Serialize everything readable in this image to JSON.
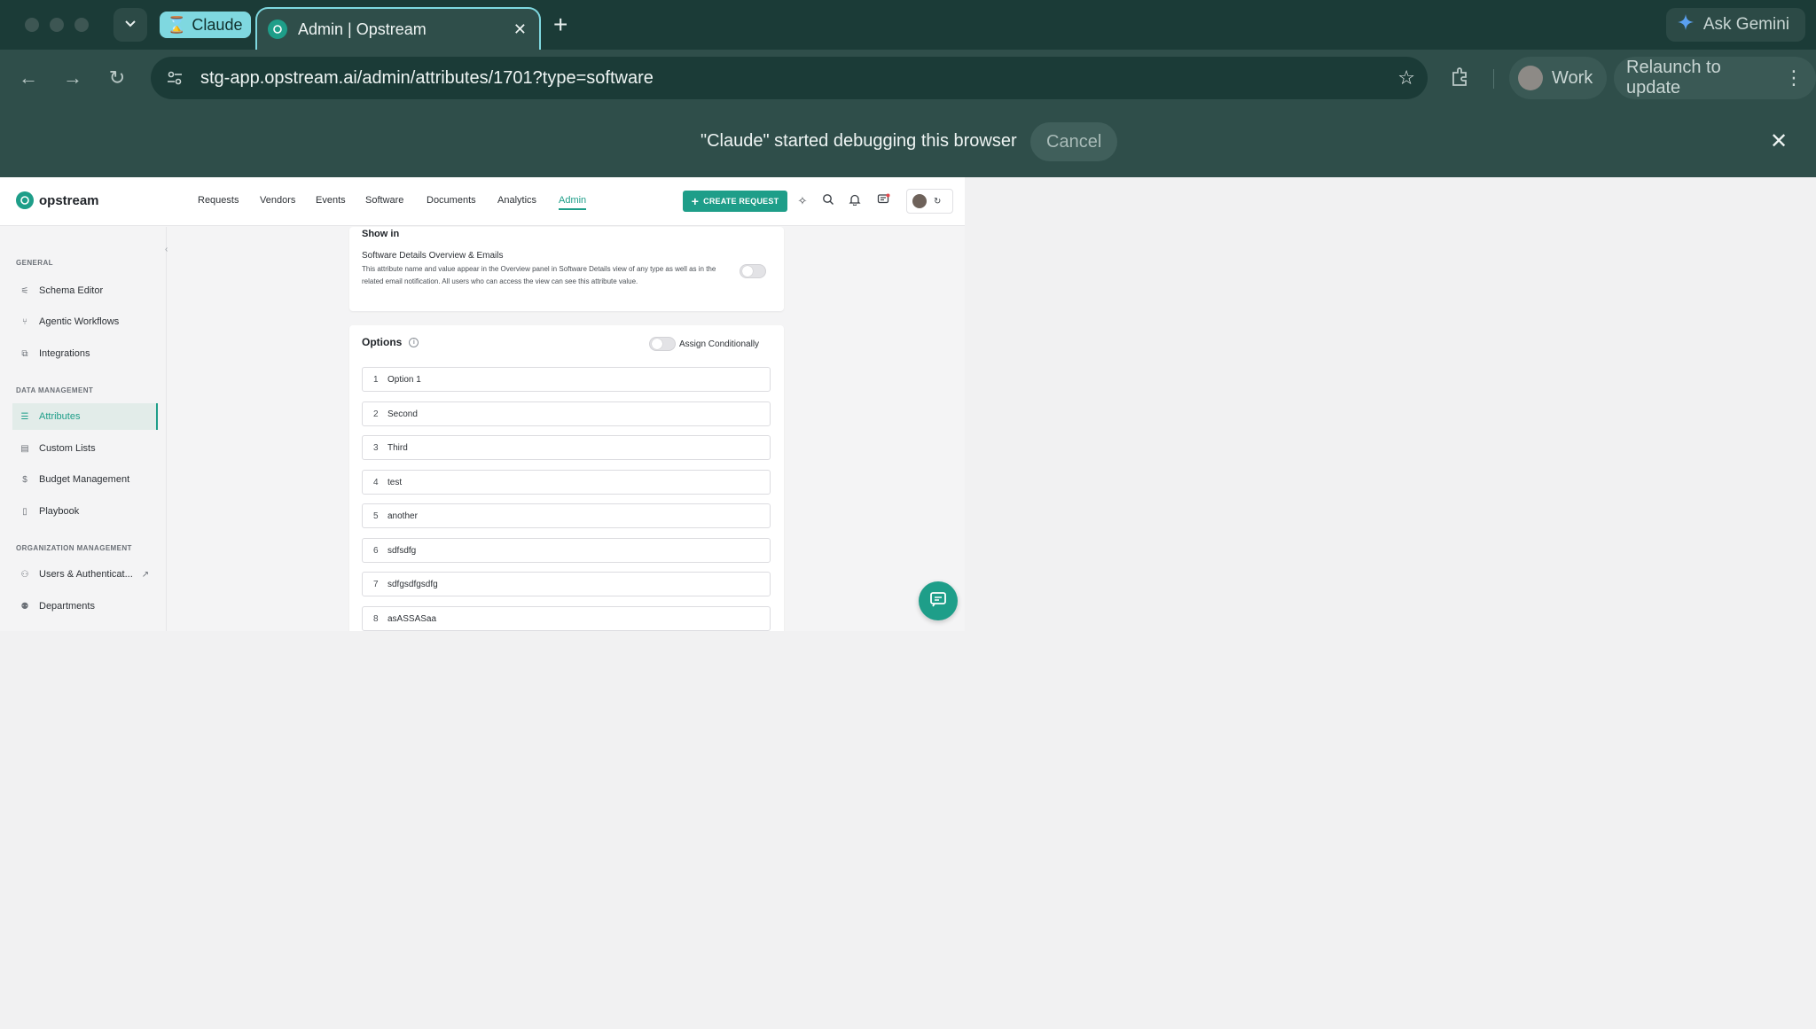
{
  "browser": {
    "claude_tab_label": "Claude",
    "active_tab_title": "Admin | Opstream",
    "gemini_label": "Ask Gemini",
    "url": "stg-app.opstream.ai/admin/attributes/1701?type=software",
    "profile_label": "Work",
    "relaunch_label": "Relaunch to update",
    "debug_message": "\"Claude\" started debugging this browser",
    "debug_cancel": "Cancel"
  },
  "app": {
    "logo_text": "opstream",
    "nav": [
      "Requests",
      "Vendors",
      "Events",
      "Software",
      "Documents",
      "Analytics",
      "Admin"
    ],
    "active_nav": "Admin",
    "create_label": "CREATE REQUEST",
    "accent_color": "#1e9e89"
  },
  "sidebar": {
    "sections": [
      {
        "label": "GENERAL",
        "items": [
          "Schema Editor",
          "Agentic Workflows",
          "Integrations"
        ]
      },
      {
        "label": "DATA MANAGEMENT",
        "items": [
          "Attributes",
          "Custom Lists",
          "Budget Management",
          "Playbook"
        ]
      },
      {
        "label": "ORGANIZATION MANAGEMENT",
        "items": [
          "Users & Authenticat...",
          "Departments"
        ]
      }
    ],
    "active_item": "Attributes"
  },
  "show_in": {
    "title": "Show in",
    "subtitle": "Software Details Overview & Emails",
    "description": "This attribute name and value appear in the Overview panel in Software Details view of any type as well as in the related email notification. All users who can access the view can see this attribute value.",
    "enabled": false
  },
  "options": {
    "title": "Options",
    "assign_label": "Assign Conditionally",
    "assign_enabled": false,
    "items": [
      {
        "num": "1",
        "value": "Option 1"
      },
      {
        "num": "2",
        "value": "Second"
      },
      {
        "num": "3",
        "value": "Third"
      },
      {
        "num": "4",
        "value": "test"
      },
      {
        "num": "5",
        "value": "another"
      },
      {
        "num": "6",
        "value": "sdfsdfg"
      },
      {
        "num": "7",
        "value": "sdfgsdfgsdfg"
      },
      {
        "num": "8",
        "value": "asASSASaa"
      }
    ]
  }
}
